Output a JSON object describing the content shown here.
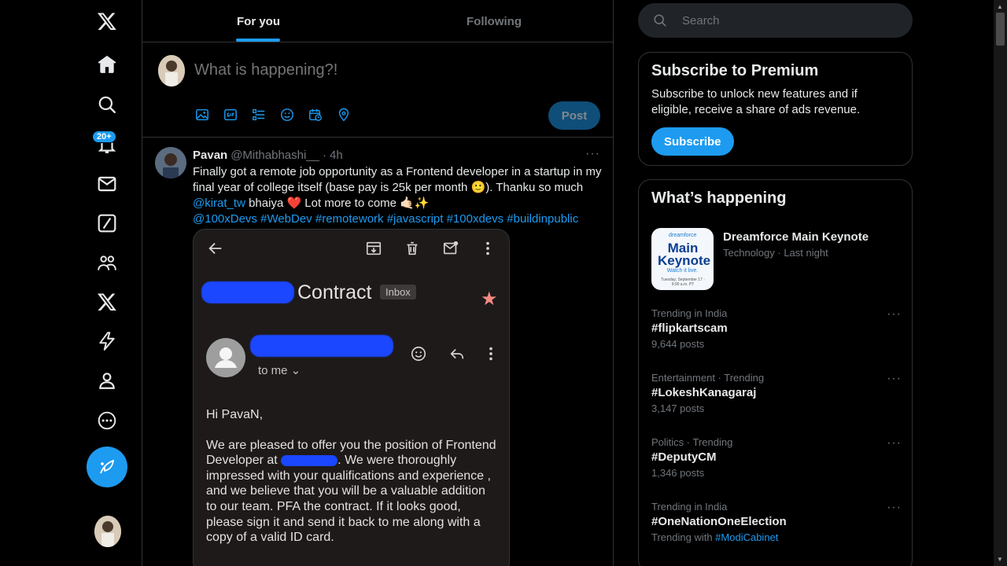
{
  "nav": {
    "items": [
      {
        "name": "x-logo-icon"
      },
      {
        "name": "home-icon"
      },
      {
        "name": "explore-icon"
      },
      {
        "name": "notifications-icon"
      },
      {
        "name": "messages-icon"
      },
      {
        "name": "grok-icon"
      },
      {
        "name": "communities-icon"
      },
      {
        "name": "premium-icon"
      },
      {
        "name": "verified-orgs-icon"
      },
      {
        "name": "profile-icon"
      },
      {
        "name": "more-icon"
      }
    ],
    "notifications_badge": "20+"
  },
  "tabs": {
    "for_you": "For you",
    "following": "Following"
  },
  "composer": {
    "placeholder": "What is happening?!",
    "post_label": "Post",
    "tools": [
      "media-icon",
      "gif-icon",
      "poll-icon",
      "emoji-icon",
      "schedule-icon",
      "location-icon"
    ]
  },
  "tweet": {
    "name": "Pavan",
    "handle": "@Mithabhashi__",
    "dot": "·",
    "time": "4h",
    "more": "···",
    "text_1": "Finally got a remote job opportunity as a Frontend developer in a startup in my final year of college itself (base pay is 25k per month 🙂). Thanku so much ",
    "mention": "@kirat_tw",
    "text_2": " bhaiya ❤️ Lot more to come 🤙🏻✨",
    "hashtags": "@100xDevs #WebDev #remotework #javascript #100xdevs #buildinpublic",
    "media": {
      "subject": "Contract",
      "label": "Inbox",
      "to_me": "to me ⌄",
      "greeting": "Hi PavaN,",
      "body_1": "We are pleased to offer you the position of Frontend Developer at",
      "body_2": ". We were thoroughly impressed with your qualifications and experience , and we believe that you will be a valuable addition to our team. PFA the contract. If it looks good, please sign it and send it back to me along with a copy of a valid ID card."
    }
  },
  "search": {
    "placeholder": "Search"
  },
  "premium": {
    "title": "Subscribe to Premium",
    "description": "Subscribe to unlock new features and if eligible, receive a share of ads revenue.",
    "button": "Subscribe"
  },
  "happening": {
    "title": "What’s happening",
    "event": {
      "title": "Dreamforce Main Keynote",
      "meta": "Technology · Last night",
      "img_brand": "dreamforce",
      "img_main": "Main Keynote",
      "img_watch": "Watch it live.",
      "img_fine": "Tuesday, September 17 · 9:00 a.m. PT"
    },
    "trends": [
      {
        "category": "Trending in India",
        "name": "#flipkartscam",
        "count": "9,644 posts"
      },
      {
        "category": "Entertainment · Trending",
        "name": "#LokeshKanagaraj",
        "count": "3,147 posts"
      },
      {
        "category": "Politics · Trending",
        "name": "#DeputyCM",
        "count": "1,346 posts"
      },
      {
        "category": "Trending in India",
        "name": "#OneNationOneElection",
        "count_prefix": "Trending with ",
        "count_link": "#ModiCabinet"
      }
    ],
    "more": "···"
  },
  "colors": {
    "accent": "#1d9bf0",
    "background": "#000000",
    "border": "#2f3336",
    "muted": "#71767b"
  }
}
